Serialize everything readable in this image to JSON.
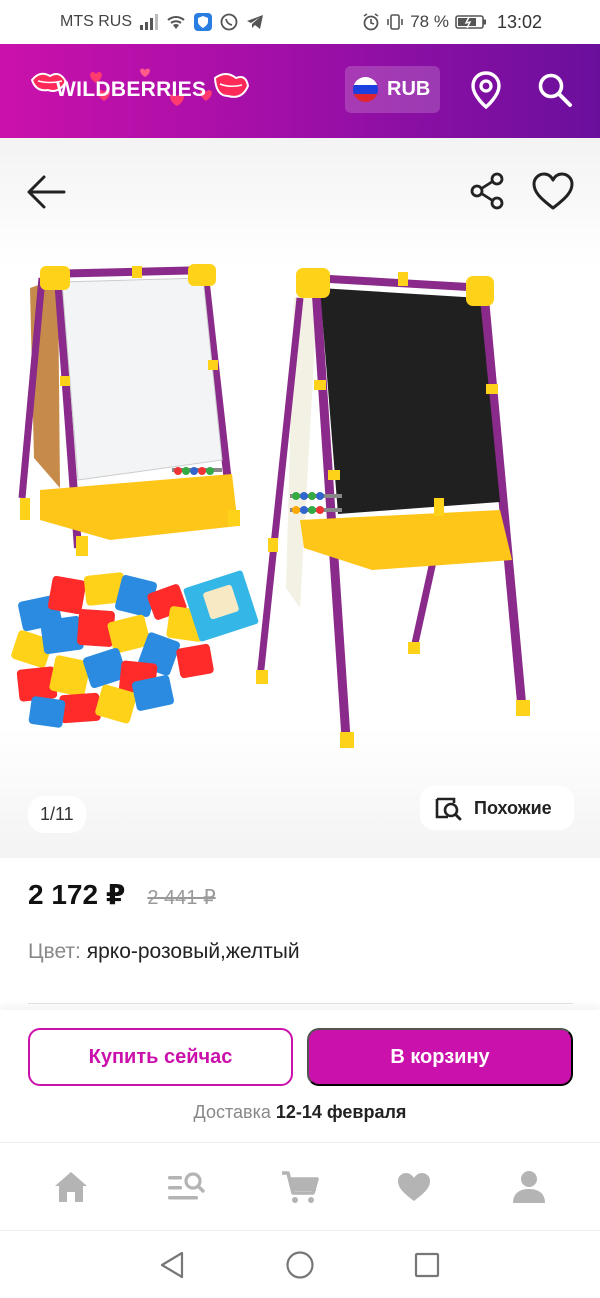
{
  "status_bar": {
    "carrier": "MTS RUS",
    "battery": "78 %",
    "time": "13:02"
  },
  "header": {
    "logo_text": "WILDBERRIES",
    "currency": "RUB",
    "brand_color": "#cb11ab",
    "icons": [
      "location-pin-icon",
      "search-icon"
    ]
  },
  "product": {
    "image_counter": "1/11",
    "similar_label": "Похожие",
    "price": "2 172 ₽",
    "old_price": "2 441 ₽",
    "color_label": "Цвет:",
    "color_value": " ярко-розовый,желтый"
  },
  "actions": {
    "buy_now": "Купить сейчас",
    "add_to_cart": "В корзину",
    "delivery_label": "Доставка ",
    "delivery_dates": "12-14 февраля"
  },
  "bottom_nav": [
    "home-icon",
    "catalog-search-icon",
    "cart-icon",
    "favorites-icon",
    "profile-icon"
  ],
  "android_nav": [
    "back-triangle-icon",
    "home-circle-icon",
    "recents-square-icon"
  ]
}
